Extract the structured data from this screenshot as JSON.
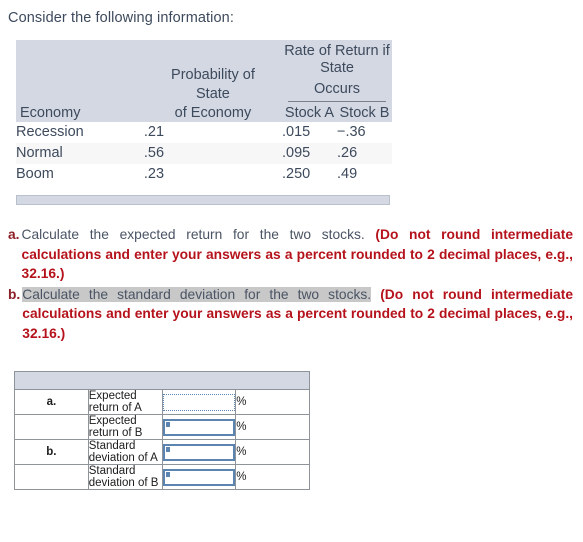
{
  "intro": {
    "text": "Consider the following information:"
  },
  "data_table": {
    "headers": {
      "economy": "Economy",
      "probability_line1": "Probability of",
      "probability_line2": "State",
      "probability_line3": "of Economy",
      "rate_of_return_line1": "Rate of Return if State",
      "rate_of_return_line2": "Occurs",
      "stock_a": "Stock A",
      "stock_b": "Stock B"
    },
    "rows": [
      {
        "economy": "Recession",
        "probability": ".21",
        "stock_a": ".015",
        "stock_b": "−.36"
      },
      {
        "economy": "Normal",
        "probability": ".56",
        "stock_a": ".095",
        "stock_b": ".26"
      },
      {
        "economy": "Boom",
        "probability": ".23",
        "stock_a": ".250",
        "stock_b": ".49"
      }
    ]
  },
  "questions": [
    {
      "marker": "a.",
      "plain": "Calculate the expected return for the two stocks.",
      "selected": false,
      "red": "(Do not round intermediate calculations and enter your answers as a percent rounded to 2 decimal places, e.g., 32.16.)"
    },
    {
      "marker": "b.",
      "plain": "Calculate the standard deviation for the two stocks.",
      "selected": true,
      "red": "(Do not round intermediate calculations and enter your answers as a percent rounded to 2 decimal places, e.g., 32.16.)"
    }
  ],
  "answer_table": {
    "rows": [
      {
        "marker": "a.",
        "label": "Expected return of A",
        "value": "",
        "unit": "%",
        "field_state": "dotted"
      },
      {
        "marker": "",
        "label": "Expected return of B",
        "value": "",
        "unit": "%",
        "field_state": "solid"
      },
      {
        "marker": "b.",
        "label": "Standard deviation of A",
        "value": "",
        "unit": "%",
        "field_state": "solid"
      },
      {
        "marker": "",
        "label": "Standard deviation of B",
        "value": "",
        "unit": "%",
        "field_state": "solid"
      }
    ]
  },
  "colors": {
    "header_fill": "#d3d8e3",
    "alt_row_fill": "#f7f7f7",
    "instruction_red": "#b5121b",
    "marker_maroon": "#8c1f27",
    "input_border_blue": "#5b84b1",
    "selection_gray": "#c8c8c8",
    "body_text": "#4a5464"
  }
}
